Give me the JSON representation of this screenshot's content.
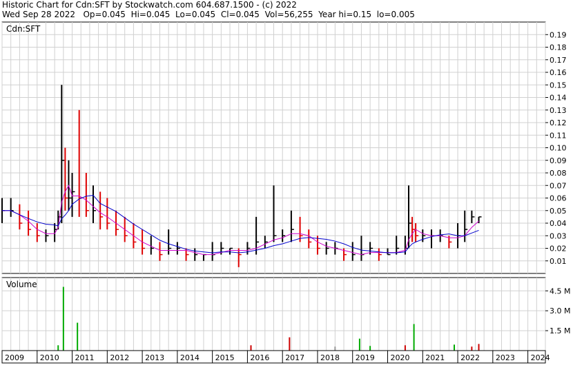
{
  "header": {
    "line1": "Historic Chart for Cdn:SFT by Stockwatch.com 604.687.1500 - (c) 2022",
    "line2": "Wed Sep 28 2022   Op=0.045  Hi=0.045  Lo=0.045  Cl=0.045  Vol=56,255  Year hi=0.15  lo=0.005"
  },
  "chart_data": [
    {
      "type": "ohlc",
      "title": "Cdn:SFT",
      "y_ticks": [
        "0.19",
        "0.18",
        "0.17",
        "0.16",
        "0.15",
        "0.14",
        "0.13",
        "0.12",
        "0.11",
        "0.10",
        "0.09",
        "0.08",
        "0.07",
        "0.06",
        "0.05",
        "0.04",
        "0.03",
        "0.02",
        "0.01"
      ],
      "ylim": [
        0,
        0.2
      ],
      "x_labels": [
        "2009",
        "2010",
        "2011",
        "2012",
        "2013",
        "2014",
        "2015",
        "2016",
        "2017",
        "2018",
        "2019",
        "2020",
        "2021",
        "2022",
        "2023",
        "2024"
      ],
      "grid": true,
      "x": [
        2009.0,
        2009.25,
        2009.5,
        2009.75,
        2010.0,
        2010.25,
        2010.5,
        2010.6,
        2010.7,
        2010.8,
        2010.9,
        2011.0,
        2011.2,
        2011.4,
        2011.6,
        2011.8,
        2012.0,
        2012.25,
        2012.5,
        2012.75,
        2013.0,
        2013.25,
        2013.5,
        2013.75,
        2014.0,
        2014.25,
        2014.5,
        2014.75,
        2015.0,
        2015.25,
        2015.5,
        2015.75,
        2016.0,
        2016.25,
        2016.5,
        2016.75,
        2017.0,
        2017.25,
        2017.5,
        2017.75,
        2018.0,
        2018.25,
        2018.5,
        2018.75,
        2019.0,
        2019.25,
        2019.5,
        2019.75,
        2020.0,
        2020.25,
        2020.5,
        2020.6,
        2020.7,
        2020.8,
        2021.0,
        2021.25,
        2021.5,
        2021.75,
        2022.0,
        2022.2,
        2022.4,
        2022.6
      ],
      "high": [
        0.06,
        0.06,
        0.055,
        0.05,
        0.04,
        0.035,
        0.04,
        0.05,
        0.15,
        0.1,
        0.09,
        0.08,
        0.13,
        0.08,
        0.07,
        0.065,
        0.06,
        0.05,
        0.045,
        0.04,
        0.035,
        0.03,
        0.025,
        0.035,
        0.025,
        0.02,
        0.02,
        0.015,
        0.025,
        0.025,
        0.02,
        0.02,
        0.025,
        0.045,
        0.03,
        0.07,
        0.035,
        0.05,
        0.045,
        0.035,
        0.03,
        0.025,
        0.025,
        0.02,
        0.025,
        0.03,
        0.025,
        0.02,
        0.02,
        0.03,
        0.03,
        0.07,
        0.045,
        0.04,
        0.035,
        0.035,
        0.035,
        0.03,
        0.04,
        0.05,
        0.05,
        0.045
      ],
      "low": [
        0.04,
        0.045,
        0.035,
        0.03,
        0.025,
        0.025,
        0.025,
        0.035,
        0.04,
        0.05,
        0.05,
        0.045,
        0.045,
        0.045,
        0.04,
        0.035,
        0.035,
        0.03,
        0.025,
        0.02,
        0.015,
        0.015,
        0.01,
        0.015,
        0.015,
        0.01,
        0.01,
        0.01,
        0.01,
        0.015,
        0.015,
        0.005,
        0.015,
        0.015,
        0.02,
        0.025,
        0.025,
        0.025,
        0.025,
        0.02,
        0.015,
        0.015,
        0.015,
        0.01,
        0.01,
        0.01,
        0.015,
        0.01,
        0.015,
        0.015,
        0.015,
        0.02,
        0.025,
        0.025,
        0.025,
        0.02,
        0.025,
        0.02,
        0.02,
        0.025,
        0.04,
        0.04
      ],
      "close": [
        0.05,
        0.05,
        0.04,
        0.035,
        0.03,
        0.03,
        0.035,
        0.045,
        0.09,
        0.06,
        0.06,
        0.065,
        0.06,
        0.05,
        0.05,
        0.045,
        0.04,
        0.035,
        0.03,
        0.025,
        0.02,
        0.02,
        0.015,
        0.02,
        0.02,
        0.015,
        0.015,
        0.015,
        0.015,
        0.02,
        0.02,
        0.015,
        0.02,
        0.025,
        0.025,
        0.03,
        0.03,
        0.035,
        0.03,
        0.025,
        0.02,
        0.02,
        0.02,
        0.015,
        0.015,
        0.015,
        0.02,
        0.015,
        0.015,
        0.02,
        0.02,
        0.04,
        0.035,
        0.03,
        0.03,
        0.03,
        0.03,
        0.025,
        0.03,
        0.035,
        0.045,
        0.045
      ],
      "ma_short_color": "#cc00cc",
      "ma_long_color": "#0000cc",
      "up_color": "#000000",
      "down_color": "#dd0000"
    },
    {
      "type": "bar",
      "title": "Volume",
      "y_ticks": [
        "4.5 M",
        "3.0 M",
        "1.5 M"
      ],
      "y_tick_values": [
        4.5,
        3.0,
        1.5
      ],
      "ylim": [
        0,
        5.5
      ],
      "x": [
        2010.6,
        2010.75,
        2011.15,
        2016.1,
        2017.2,
        2018.5,
        2019.2,
        2019.5,
        2020.5,
        2020.75,
        2021.9,
        2022.4,
        2022.6
      ],
      "values": [
        0.4,
        4.8,
        2.1,
        0.4,
        1.0,
        0.3,
        0.9,
        0.35,
        0.4,
        2.0,
        0.45,
        0.3,
        0.5
      ],
      "colors": [
        "#00aa00",
        "#00aa00",
        "#00aa00",
        "#cc0000",
        "#cc0000",
        "#999999",
        "#00aa00",
        "#00aa00",
        "#cc0000",
        "#00aa00",
        "#00aa00",
        "#cc0000",
        "#cc0000"
      ]
    }
  ]
}
